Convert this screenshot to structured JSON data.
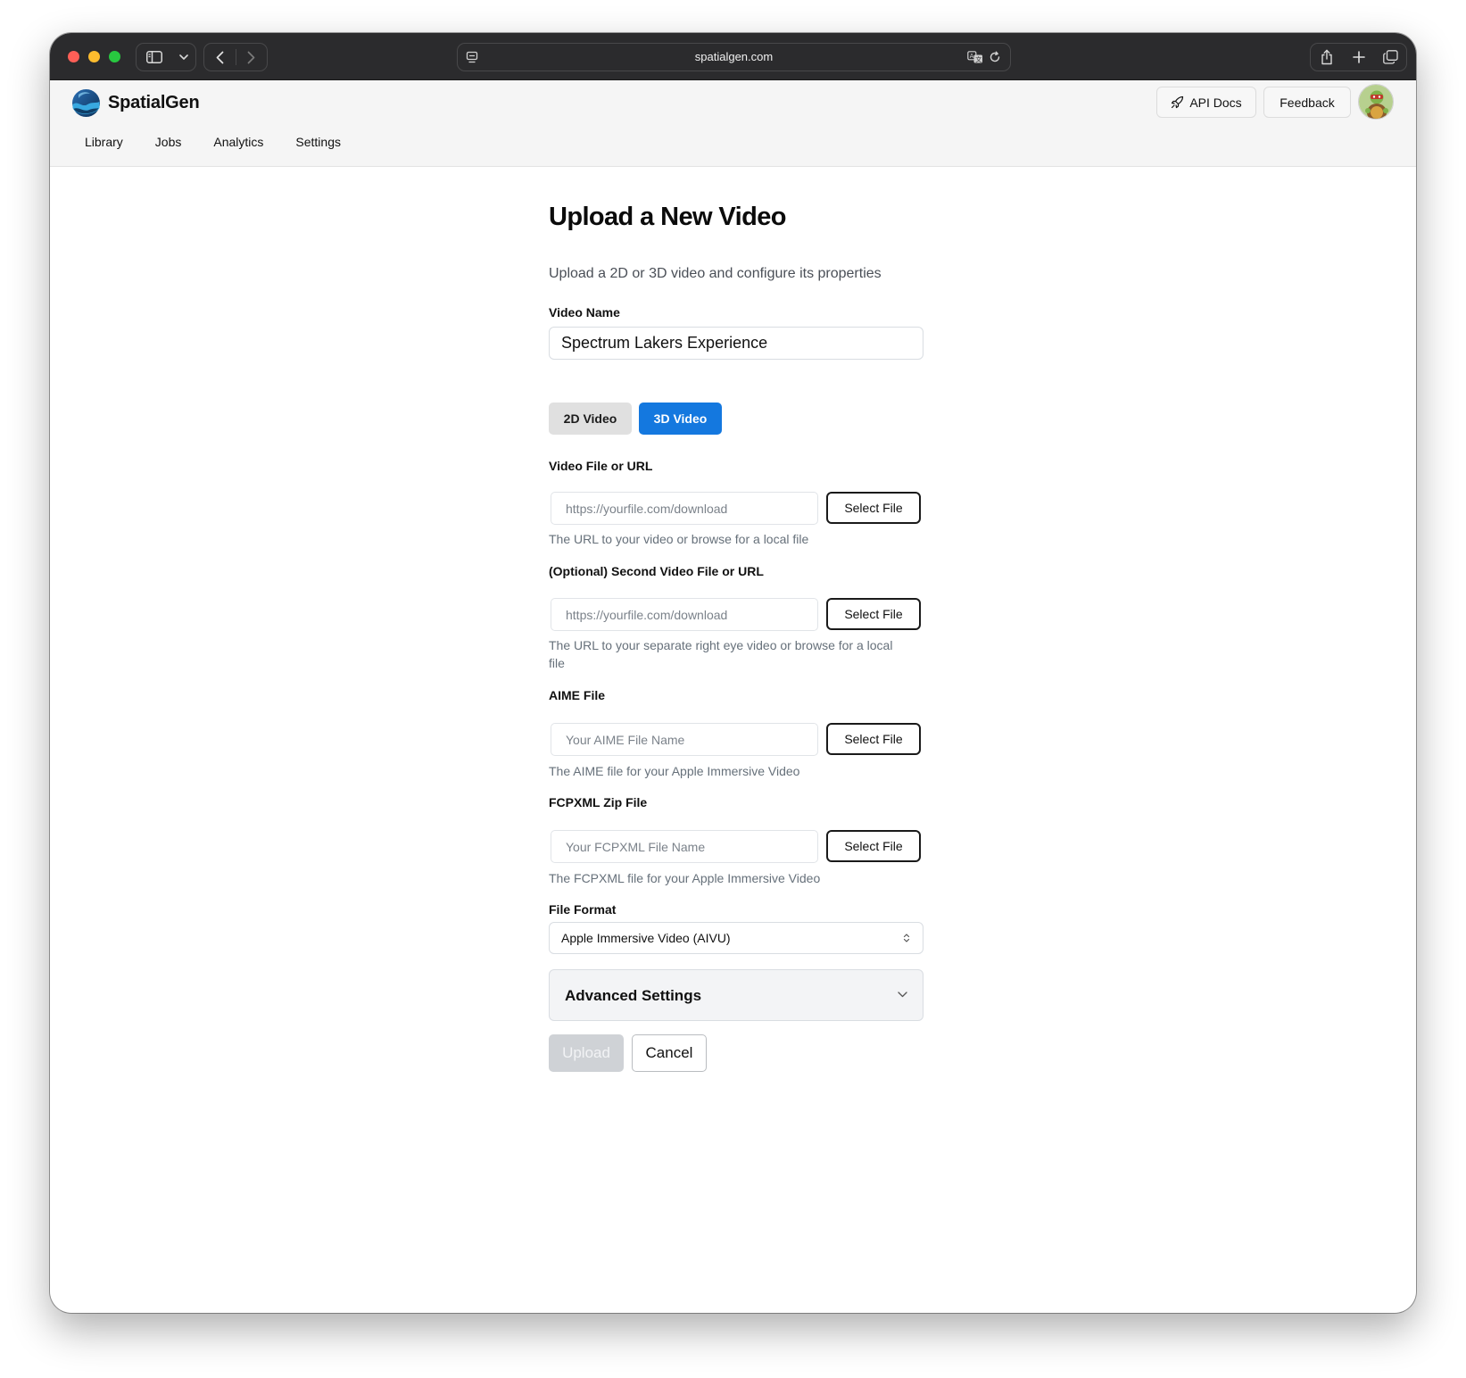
{
  "browser": {
    "url": "spatialgen.com"
  },
  "app": {
    "name": "SpatialGen",
    "api_docs_label": "API Docs",
    "feedback_label": "Feedback",
    "nav": [
      "Library",
      "Jobs",
      "Analytics",
      "Settings"
    ]
  },
  "form": {
    "title": "Upload a New Video",
    "subtitle": "Upload a 2D or 3D video and configure its properties",
    "video_name_label": "Video Name",
    "video_name_value": "Spectrum Lakers Experience",
    "type_toggle": {
      "option_2d": "2D Video",
      "option_3d": "3D Video",
      "selected": "3D Video"
    },
    "video_file": {
      "label": "Video File or URL",
      "placeholder": "https://yourfile.com/download",
      "button": "Select File",
      "help": "The URL to your video or browse for a local file"
    },
    "second_video": {
      "label": "(Optional) Second Video File or URL",
      "placeholder": "https://yourfile.com/download",
      "button": "Select File",
      "help": "The URL to your separate right eye video or browse for a local file"
    },
    "aime": {
      "label": "AIME File",
      "placeholder": "Your AIME File Name",
      "button": "Select File",
      "help": "The AIME file for your Apple Immersive Video"
    },
    "fcpxml": {
      "label": "FCPXML Zip File",
      "placeholder": "Your FCPXML File Name",
      "button": "Select File",
      "help": "The FCPXML file for your Apple Immersive Video"
    },
    "file_format": {
      "label": "File Format",
      "selected": "Apple Immersive Video (AIVU)"
    },
    "advanced_label": "Advanced Settings",
    "upload_label": "Upload",
    "cancel_label": "Cancel"
  },
  "colors": {
    "accent": "#1478df",
    "titlebar": "#2b2b2d",
    "header_bg": "#f5f5f5"
  }
}
